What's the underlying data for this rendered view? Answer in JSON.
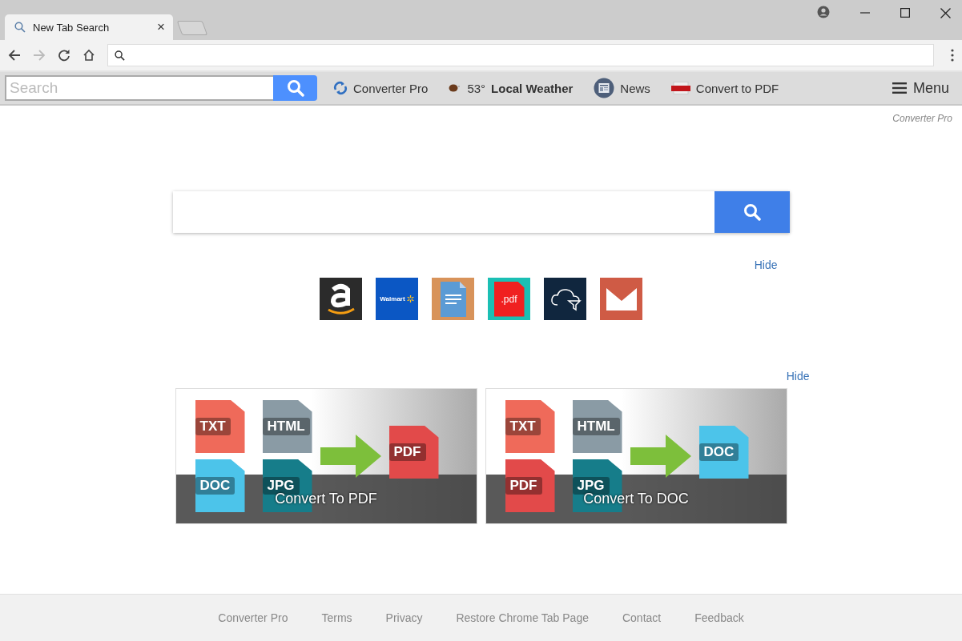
{
  "tab": {
    "title": "New Tab Search",
    "close": "×"
  },
  "toolbar_ext": {
    "search_placeholder": "Search",
    "items": [
      {
        "kind": "converter",
        "text": "Converter Pro"
      },
      {
        "kind": "weather",
        "temp": "53°",
        "text": "Local Weather"
      },
      {
        "kind": "news",
        "text": "News"
      },
      {
        "kind": "pdf",
        "text": "Convert to PDF"
      }
    ],
    "menu": "Menu"
  },
  "brand": "Converter Pro",
  "quick_links": {
    "hide": "Hide",
    "tiles": [
      {
        "kind": "amazon",
        "color": "#2b2b2b"
      },
      {
        "kind": "walmart",
        "color": "#0b57c4",
        "text": "Walmart"
      },
      {
        "kind": "docs",
        "color": "#d8935a"
      },
      {
        "kind": "pdf",
        "color": "#1bbfb4",
        "text": ".pdf"
      },
      {
        "kind": "cloud",
        "color": "#10263e"
      },
      {
        "kind": "mail",
        "color": "#cf5b45"
      }
    ]
  },
  "cards": {
    "hide": "Hide",
    "items": [
      {
        "caption": "Convert To PDF",
        "sources": [
          {
            "label": "TXT",
            "color": "#ef6a5a"
          },
          {
            "label": "HTML",
            "color": "#8a9ba5"
          },
          {
            "label": "DOC",
            "color": "#4cc4ea"
          },
          {
            "label": "JPG",
            "color": "#167d8a"
          }
        ],
        "target": {
          "label": "PDF",
          "color": "#e24a4a"
        }
      },
      {
        "caption": "Convert To DOC",
        "sources": [
          {
            "label": "TXT",
            "color": "#ef6a5a"
          },
          {
            "label": "HTML",
            "color": "#8a9ba5"
          },
          {
            "label": "PDF",
            "color": "#e24a4a"
          },
          {
            "label": "JPG",
            "color": "#167d8a"
          }
        ],
        "target": {
          "label": "DOC",
          "color": "#4cc4ea"
        }
      }
    ]
  },
  "footer": [
    "Converter Pro",
    "Terms",
    "Privacy",
    "Restore Chrome Tab Page",
    "Contact",
    "Feedback"
  ]
}
